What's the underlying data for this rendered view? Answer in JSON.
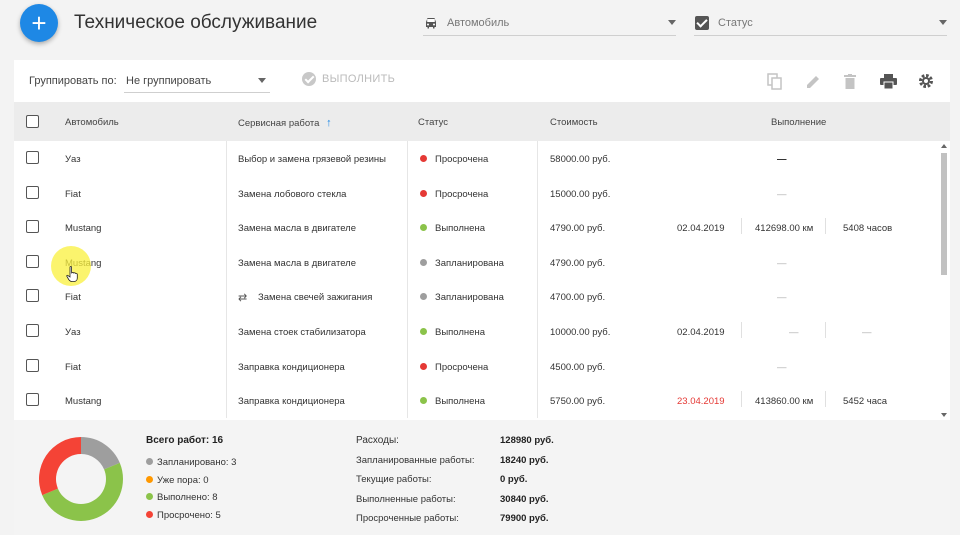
{
  "header": {
    "add_icon": "plus-icon",
    "title": "Техническое обслуживание",
    "filters": {
      "car": {
        "icon": "car-icon",
        "placeholder": "Автомобиль"
      },
      "status": {
        "icon": "checkbox-checked-icon",
        "placeholder": "Статус"
      }
    }
  },
  "toolbar": {
    "group_label": "Группировать по:",
    "group_value": "Не группировать",
    "execute_label": "ВЫПОЛНИТЬ",
    "icons": [
      "copy-icon",
      "edit-icon",
      "delete-icon",
      "print-icon",
      "settings-icon"
    ]
  },
  "table": {
    "columns": {
      "car": "Автомобиль",
      "work": "Сервисная работа",
      "status": "Статус",
      "cost": "Стоимость",
      "execution": "Выполнение"
    },
    "sort": {
      "column": "work",
      "direction": "asc"
    },
    "rows": [
      {
        "car": "Уаз",
        "work": "Выбор и замена грязевой резины",
        "status": "Просрочена",
        "status_color": "#e53935",
        "cost": "58000.00 руб.",
        "date": "",
        "mileage": "",
        "hours": "",
        "dash": "—",
        "dash_bold": true,
        "recurring": false
      },
      {
        "car": "Fiat",
        "work": "Замена лобового стекла",
        "status": "Просрочена",
        "status_color": "#e53935",
        "cost": "15000.00 руб.",
        "date": "",
        "mileage": "",
        "hours": "",
        "dash": "—",
        "dash_bold": false,
        "recurring": false
      },
      {
        "car": "Mustang",
        "work": "Замена масла в двигателе",
        "status": "Выполнена",
        "status_color": "#8bc34a",
        "cost": "4790.00 руб.",
        "date": "02.04.2019",
        "date_color": "#333333",
        "mileage": "412698.00 км",
        "hours": "5408 часов",
        "dash": "",
        "recurring": false
      },
      {
        "car": "Mustang",
        "work": "Замена масла в двигателе",
        "status": "Запланирована",
        "status_color": "#9e9e9e",
        "cost": "4790.00 руб.",
        "date": "",
        "mileage": "",
        "hours": "",
        "dash": "—",
        "dash_bold": false,
        "recurring": false
      },
      {
        "car": "Fiat",
        "work": "Замена свечей зажигания",
        "status": "Запланирована",
        "status_color": "#9e9e9e",
        "cost": "4700.00 руб.",
        "date": "",
        "mileage": "",
        "hours": "",
        "dash": "—",
        "dash_bold": false,
        "recurring": true
      },
      {
        "car": "Уаз",
        "work": "Замена стоек стабилизатора",
        "status": "Выполнена",
        "status_color": "#8bc34a",
        "cost": "10000.00 руб.",
        "date": "02.04.2019",
        "date_color": "#333333",
        "mileage": "—",
        "hours": "—",
        "dash": "",
        "recurring": false
      },
      {
        "car": "Fiat",
        "work": "Заправка кондиционера",
        "status": "Просрочена",
        "status_color": "#e53935",
        "cost": "4500.00 руб.",
        "date": "",
        "mileage": "",
        "hours": "",
        "dash": "—",
        "dash_bold": false,
        "recurring": false
      },
      {
        "car": "Mustang",
        "work": "Заправка кондиционера",
        "status": "Выполнена",
        "status_color": "#8bc34a",
        "cost": "5750.00 руб.",
        "date": "23.04.2019",
        "date_color": "#e53935",
        "mileage": "413860.00 км",
        "hours": "5452 часа",
        "dash": "",
        "recurring": false
      }
    ]
  },
  "summary": {
    "total_label": "Всего работ: 16",
    "legend": [
      {
        "label": "Запланировано: 3",
        "color": "#9e9e9e",
        "value": 3
      },
      {
        "label": "Уже пора: 0",
        "color": "#ff9800",
        "value": 0
      },
      {
        "label": "Выполнено: 8",
        "color": "#8bc34a",
        "value": 8
      },
      {
        "label": "Просрочено: 5",
        "color": "#f44336",
        "value": 5
      }
    ],
    "expenses": [
      {
        "label": "Расходы:",
        "value": "128980 руб."
      },
      {
        "label": "Запланированные работы:",
        "value": "18240 руб."
      },
      {
        "label": "Текущие работы:",
        "value": "0 руб."
      },
      {
        "label": "Выполненные работы:",
        "value": "30840 руб."
      },
      {
        "label": "Просроченные работы:",
        "value": "79900 руб."
      }
    ]
  }
}
